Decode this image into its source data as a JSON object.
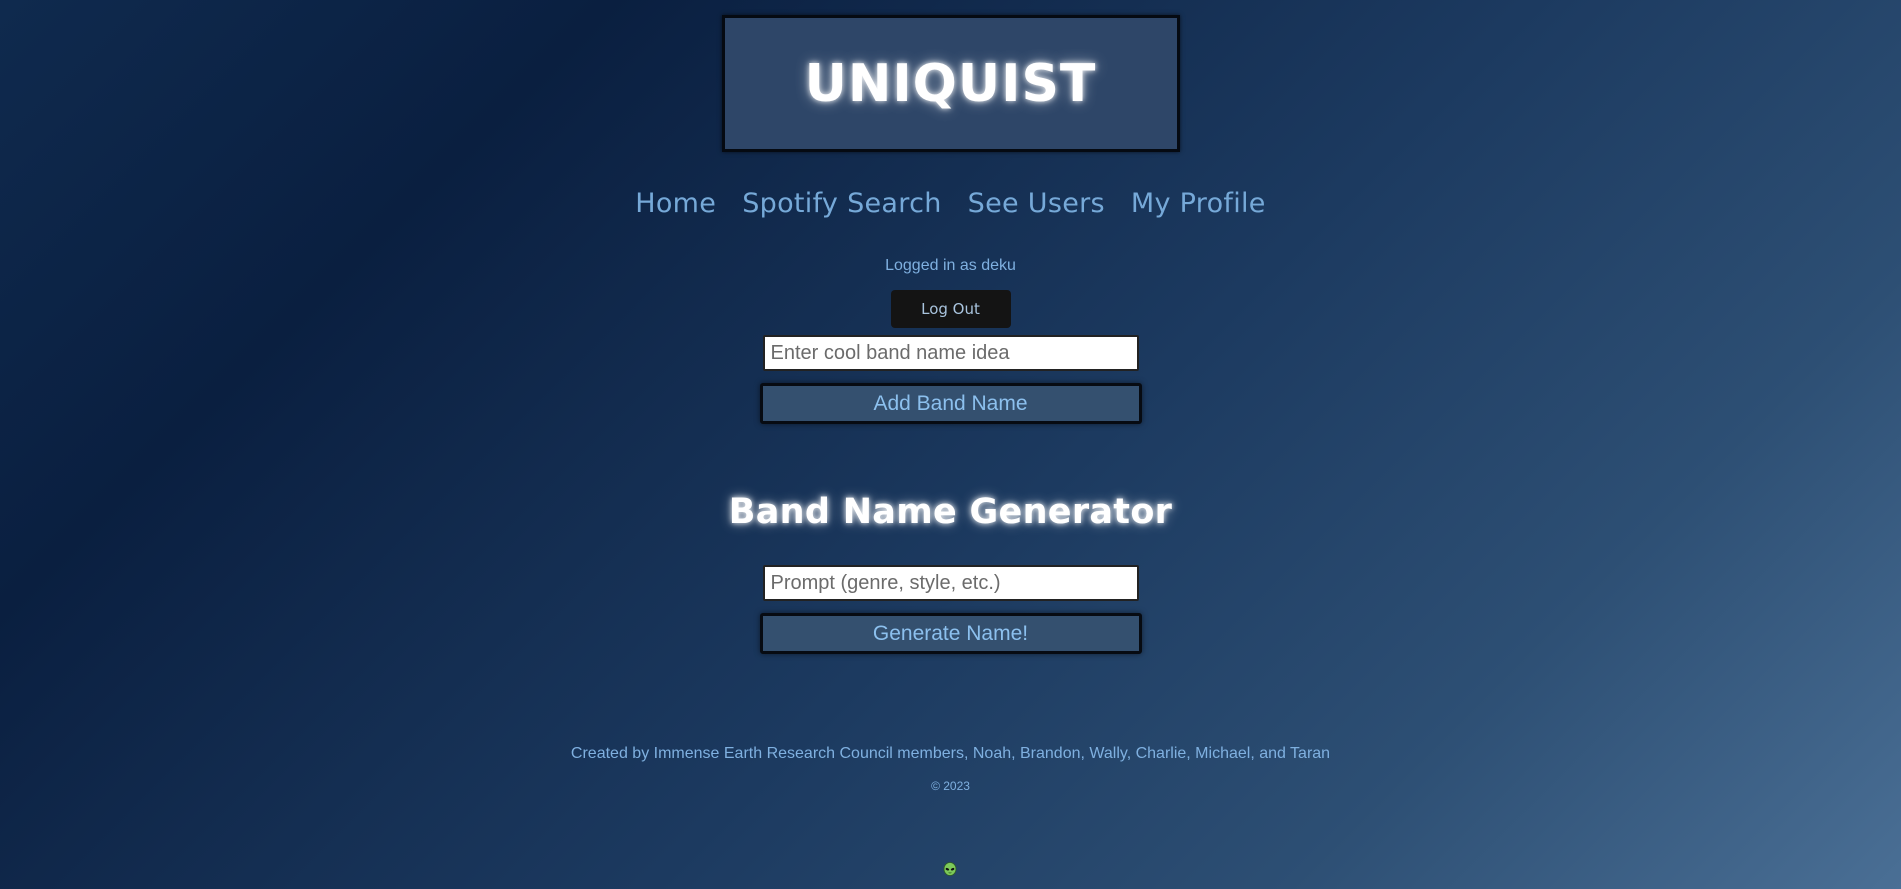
{
  "header": {
    "title": "UNIQUIST"
  },
  "nav": {
    "items": [
      {
        "label": "Home"
      },
      {
        "label": "Spotify Search"
      },
      {
        "label": "See Users"
      },
      {
        "label": "My Profile"
      }
    ]
  },
  "session": {
    "logged_in_text": "Logged in as deku",
    "logout_label": "Log Out"
  },
  "add_band": {
    "input_placeholder": "Enter cool band name idea",
    "input_value": "",
    "button_label": "Add Band Name"
  },
  "generator": {
    "heading": "Band Name Generator",
    "input_placeholder": "Prompt (genre, style, etc.)",
    "input_value": "",
    "button_label": "Generate Name!"
  },
  "footer": {
    "credit": "Created by Immense Earth Research Council members, Noah, Brandon, Wally, Charlie, Michael, and Taran",
    "copyright": "© 2023",
    "icon": "alien-icon"
  },
  "colors": {
    "link": "#76a9d8",
    "button_bg": "#34506f",
    "title_box_bg": "#2e4668",
    "logout_bg": "#141414"
  }
}
